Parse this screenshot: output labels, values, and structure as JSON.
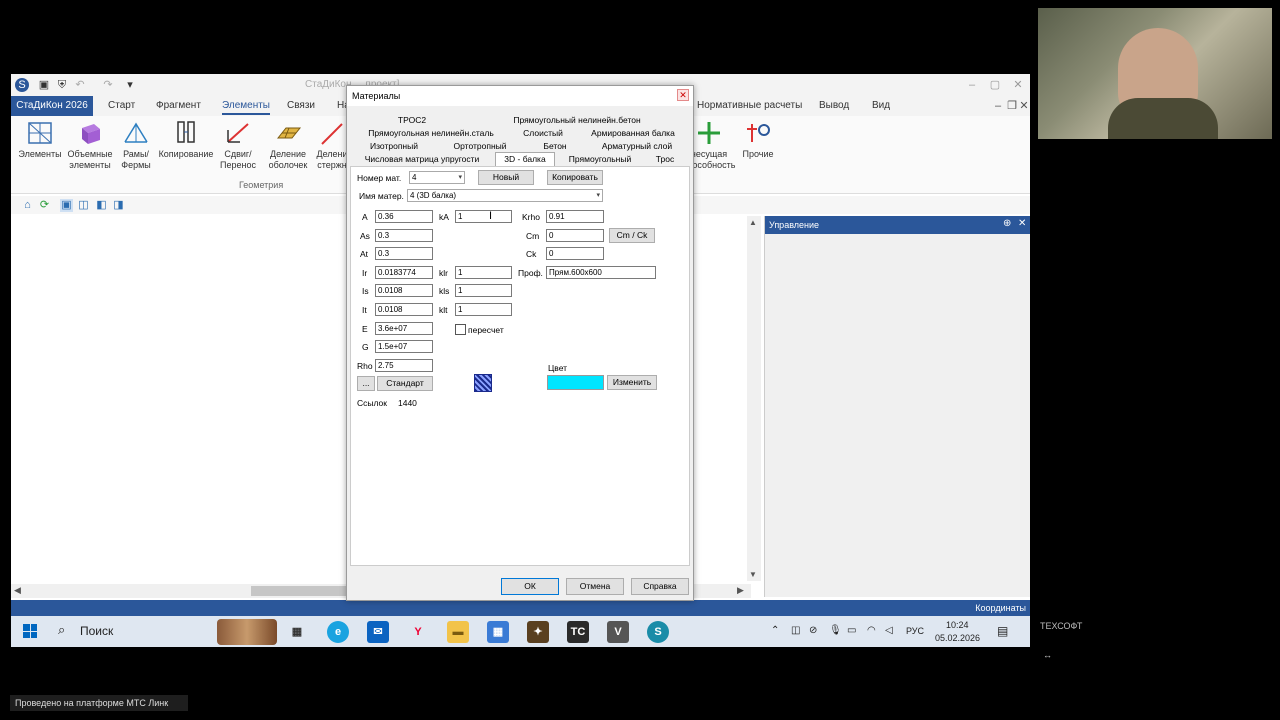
{
  "app": {
    "title_faded": "СтаДиКон ... проект]",
    "app_tab": "СтаДиКон 2026",
    "menu_tabs": [
      "Старт",
      "Фрагмент",
      "Элементы",
      "Связи",
      "На"
    ],
    "right_tabs": [
      "Нормативные расчеты",
      "Вывод",
      "Вид"
    ],
    "ribbon_buttons": [
      "Элементы",
      "Объемные элементы",
      "Рамы/ Фермы",
      "Копирование",
      "Сдвиг/ Перенос",
      "Деление оболочек",
      "Делени стержн"
    ],
    "ribbon_right_buttons": [
      "несущая способность",
      "Прочие"
    ],
    "ribbon_group": "Геометрия",
    "panel_title": "Управление",
    "status_right": "Координаты"
  },
  "taskbar": {
    "search": "Поиск",
    "lang": "РУС",
    "time": "10:24",
    "date": "05.02.2026"
  },
  "dialog": {
    "title": "Материалы",
    "tabs_row1": [
      "ТРОС2",
      "Прямоугольный нелинейн.бетон"
    ],
    "tabs_row2": [
      "Прямоугольная нелинейн.сталь",
      "Слоистый",
      "Армированная балка"
    ],
    "tabs_row3": [
      "Изотропный",
      "Ортотропный",
      "Бетон",
      "Арматурный слой"
    ],
    "tabs_row4": [
      "Числовая матрица упругости",
      "3D - балка",
      "Прямоугольный",
      "Трос"
    ],
    "mat_number_label": "Номер мат.",
    "mat_number": "4",
    "new_button": "Новый",
    "copy_button": "Копировать",
    "mat_name_label": "Имя матер.",
    "mat_name": "4 (3D балка)",
    "fields_left": [
      {
        "label": "A",
        "value": "0.36"
      },
      {
        "label": "As",
        "value": "0.3"
      },
      {
        "label": "At",
        "value": "0.3"
      },
      {
        "label": "Ir",
        "value": "0.0183774"
      },
      {
        "label": "Is",
        "value": "0.0108"
      },
      {
        "label": "It",
        "value": "0.0108"
      },
      {
        "label": "E",
        "value": "3.6e+07"
      },
      {
        "label": "G",
        "value": "1.5e+07"
      },
      {
        "label": "Rho",
        "value": "2.75"
      }
    ],
    "fields_mid": [
      {
        "label": "kA",
        "value": "1"
      },
      {
        "label": "klr",
        "value": "1"
      },
      {
        "label": "kls",
        "value": "1"
      },
      {
        "label": "klt",
        "value": "1"
      }
    ],
    "recalc_label": "пересчет",
    "fields_right": [
      {
        "label": "Krho",
        "value": "0.91"
      },
      {
        "label": "Cm",
        "value": "0"
      },
      {
        "label": "Ck",
        "value": "0"
      }
    ],
    "cmck_button": "Cm / Ck",
    "prof_label": "Проф.",
    "prof_value": "Прям.600x600",
    "dots_button": "...",
    "standard_button": "Стандарт",
    "color_label": "Цвет",
    "color_value": "#00e5ff",
    "change_button": "Изменить",
    "links_label": "Ссылок",
    "links_value": "1440",
    "ok_button": "ОК",
    "cancel_button": "Отмена",
    "help_button": "Справка"
  },
  "overlay": {
    "brand": "ТЕХСОФТ",
    "caption": "Проведено на платформе МТС Линк"
  }
}
